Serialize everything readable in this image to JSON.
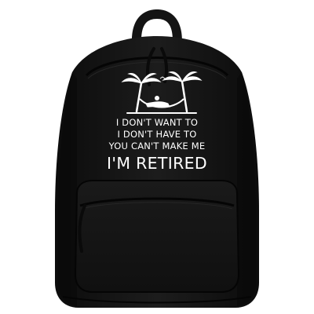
{
  "product": {
    "name": "Backpack",
    "color": "#161616"
  },
  "print": {
    "line1": "I DON'T WANT TO",
    "line2": "I DON'T HAVE TO",
    "line3": "YOU CAN'T MAKE ME",
    "line4": "I'M RETIRED",
    "ink_color": "#ffffff",
    "graphic": "palm-trees-hammock-icon"
  },
  "background_color": "#ffffff"
}
